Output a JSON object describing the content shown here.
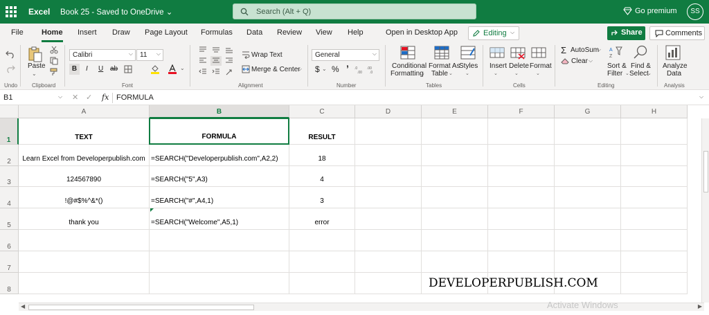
{
  "titlebar": {
    "app_name": "Excel",
    "doc_title": "Book 25 - Saved to OneDrive ⌄",
    "search_placeholder": "Search (Alt + Q)",
    "premium": "Go premium",
    "avatar": "SS"
  },
  "menu": {
    "tabs": [
      "File",
      "Home",
      "Insert",
      "Draw",
      "Page Layout",
      "Formulas",
      "Data",
      "Review",
      "View",
      "Help",
      "Open in Desktop App"
    ],
    "active_tab": "Home",
    "editing": "Editing",
    "share": "Share",
    "comments": "Comments"
  },
  "ribbon": {
    "undo": {
      "label": "Undo"
    },
    "clipboard": {
      "paste": "Paste",
      "label": "Clipboard"
    },
    "font": {
      "name": "Calibri",
      "size": "11",
      "label": "Font",
      "bold": "B",
      "italic": "I",
      "underline": "U",
      "strike": "ab"
    },
    "alignment": {
      "wrap_text": "Wrap Text",
      "merge_center": "Merge & Center",
      "label": "Alignment"
    },
    "number": {
      "format": "General",
      "label": "Number",
      "currency": "$",
      "percent": "%",
      "comma": "’"
    },
    "tables": {
      "conditional": "Conditional",
      "formatting": "Formatting",
      "format_as": "Format As",
      "table": "Table",
      "styles": "Styles",
      "label": "Tables"
    },
    "cells": {
      "insert": "Insert",
      "delete": "Delete",
      "format": "Format",
      "label": "Cells"
    },
    "editing": {
      "autosum": "AutoSum",
      "clear": "Clear",
      "sort": "Sort &",
      "filter": "Filter",
      "find": "Find &",
      "select": "Select",
      "label": "Editing"
    },
    "analysis": {
      "analyze": "Analyze",
      "data": "Data",
      "label": "Analysis"
    }
  },
  "formula_bar": {
    "name_box": "B1",
    "fx": "fx",
    "value": "FORMULA"
  },
  "grid": {
    "columns": [
      "A",
      "B",
      "C",
      "D",
      "E",
      "F",
      "G",
      "H"
    ],
    "selected_column": "B",
    "rows": [
      "1",
      "2",
      "3",
      "4",
      "5",
      "6",
      "7",
      "8"
    ],
    "selected_row": "1",
    "cells": [
      [
        "TEXT",
        "FORMULA",
        "RESULT"
      ],
      [
        "Learn Excel from Developerpublish.com",
        "=SEARCH(\"Developerpublish.com\",A2,2)",
        "18"
      ],
      [
        "124567890",
        "=SEARCH(\"5\",A3)",
        "4"
      ],
      [
        "!@#$%^&*()",
        "=SEARCH(\"#\",A4,1)",
        "3"
      ],
      [
        "thank you",
        "=SEARCH(\"Welcome\",A5,1)",
        "error"
      ]
    ]
  },
  "watermark": "DEVELOPERPUBLISH.COM",
  "activate_windows": "Activate Windows",
  "colors": {
    "brand": "#107c41",
    "ribbon_bg": "#f3f2f1",
    "grid_line": "#e1dfdd"
  }
}
